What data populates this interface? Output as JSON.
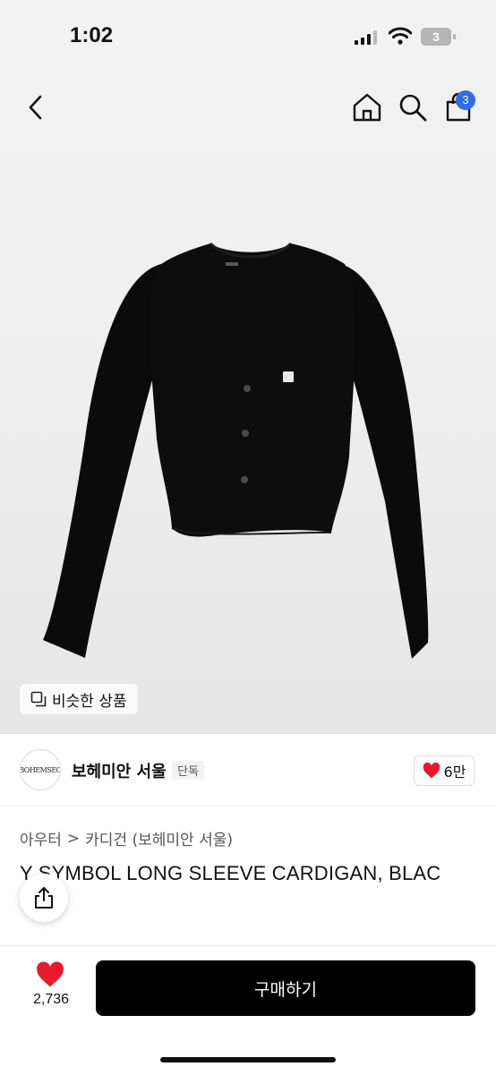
{
  "status_bar": {
    "time": "1:02",
    "battery_level": "3",
    "icons": [
      "cellular-signal-icon",
      "wifi-icon",
      "battery-icon"
    ]
  },
  "top_nav": {
    "icons": [
      "back-chevron-icon",
      "home-icon",
      "search-icon",
      "shopping-bag-icon"
    ],
    "cart_count": "3"
  },
  "product_image": {
    "subject": "black cropped cardigan"
  },
  "similar_button": {
    "label": "비슷한 상품"
  },
  "brand": {
    "logo_text": "BOHEMSEO",
    "name": "보헤미안 서울",
    "badge": "단독",
    "likes": "6만"
  },
  "breadcrumb": {
    "level1": "아우터",
    "separator": ">",
    "level2": "카디건 (보헤미안 서울)"
  },
  "product": {
    "title": "Y SYMBOL LONG SLEEVE CARDIGAN, BLAC"
  },
  "bottom_bar": {
    "wish_count": "2,736",
    "buy_label": "구매하기"
  },
  "colors": {
    "accent_blue": "#2f6ee6",
    "heart_red": "#e8192c",
    "button_black": "#000000"
  }
}
